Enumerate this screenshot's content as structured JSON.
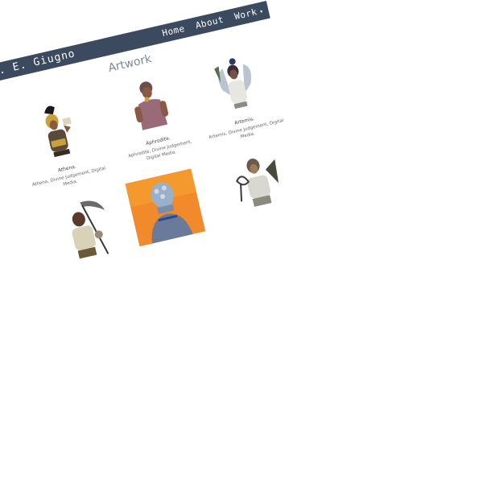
{
  "site": {
    "brand": "C. E. Giugno",
    "nav": [
      "Home",
      "About",
      "Work"
    ]
  },
  "page": {
    "title": "Artwork"
  },
  "gallery": [
    {
      "title": "Athena.",
      "meta": "Athena, Divine Judgement, Digital Media."
    },
    {
      "title": "Aphrodite.",
      "meta": "Aphrodite, Divine Judgement, Digital Media."
    },
    {
      "title": "Artemis.",
      "meta": "Artemis, Divine Judgement, Digital Media."
    },
    {
      "title": "",
      "meta": ""
    },
    {
      "title": "",
      "meta": ""
    },
    {
      "title": "",
      "meta": ""
    }
  ]
}
